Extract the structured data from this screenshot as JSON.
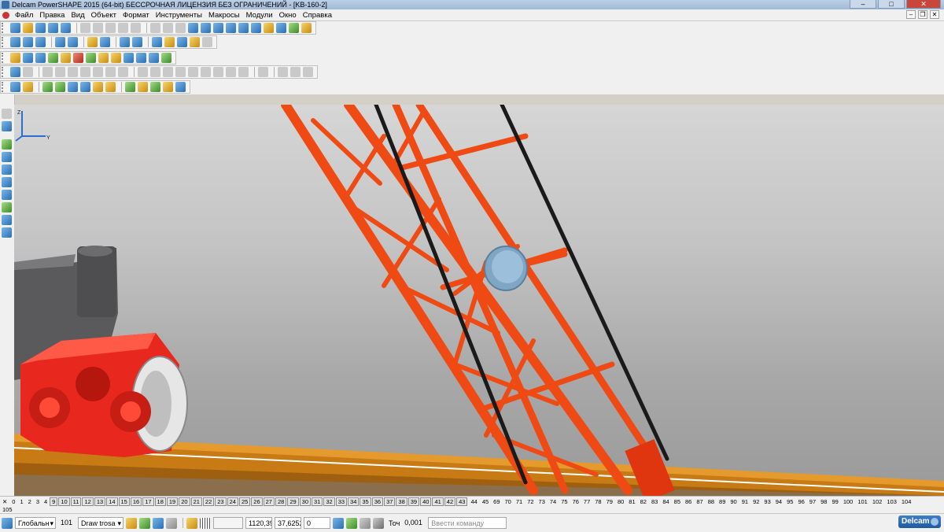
{
  "window": {
    "title": "Delcam PowerSHAPE 2015 (64-bit) БЕССРОЧНАЯ ЛИЦЕНЗИЯ БЕЗ ОГРАНИЧЕНИЙ - [KB-160-2]",
    "minimize": "–",
    "maximize": "□",
    "close": "✕"
  },
  "menu": {
    "items": [
      "Файл",
      "Правка",
      "Вид",
      "Объект",
      "Формат",
      "Инструменты",
      "Макросы",
      "Модули",
      "Окно",
      "Справка"
    ],
    "mdi_minimize": "–",
    "mdi_restore": "❐",
    "mdi_close": "✕"
  },
  "layers": {
    "first_tab": "0",
    "tabs": [
      "0",
      "1",
      "2",
      "3",
      "4",
      "9",
      "10",
      "11",
      "12",
      "13",
      "14",
      "15",
      "16",
      "17",
      "18",
      "19",
      "20",
      "21",
      "22",
      "23",
      "24",
      "25",
      "26",
      "27",
      "28",
      "29",
      "30",
      "31",
      "32",
      "33",
      "34",
      "35",
      "36",
      "37",
      "38",
      "39",
      "40",
      "41",
      "42",
      "43",
      "44",
      "45",
      "69",
      "70",
      "71",
      "72",
      "73",
      "74",
      "75",
      "76",
      "77",
      "78",
      "79",
      "80",
      "81",
      "82",
      "83",
      "84",
      "85",
      "86",
      "87",
      "88",
      "89",
      "90",
      "91",
      "92",
      "93",
      "94",
      "95",
      "96",
      "97",
      "98",
      "99",
      "100",
      "101",
      "102",
      "103",
      "104"
    ],
    "boxed_from": 5,
    "boxed_to": 39,
    "second_row": "105"
  },
  "status": {
    "workplane": "Глобальн",
    "level_number": "101",
    "level_name": "Draw trosa",
    "x_coord": "1120,39",
    "y_coord": "37,6252",
    "z_coord": "0",
    "tolerance_label": "Точ",
    "tolerance_value": "0,001",
    "command_placeholder": "Ввести команду"
  },
  "brand": {
    "logo": "Delcam"
  },
  "colors": {
    "structure": "#f04a14",
    "cable": "#1a1a1a",
    "bogie": "#e8281e",
    "arm": "#5a5a5c",
    "rail": "#c87a14"
  }
}
